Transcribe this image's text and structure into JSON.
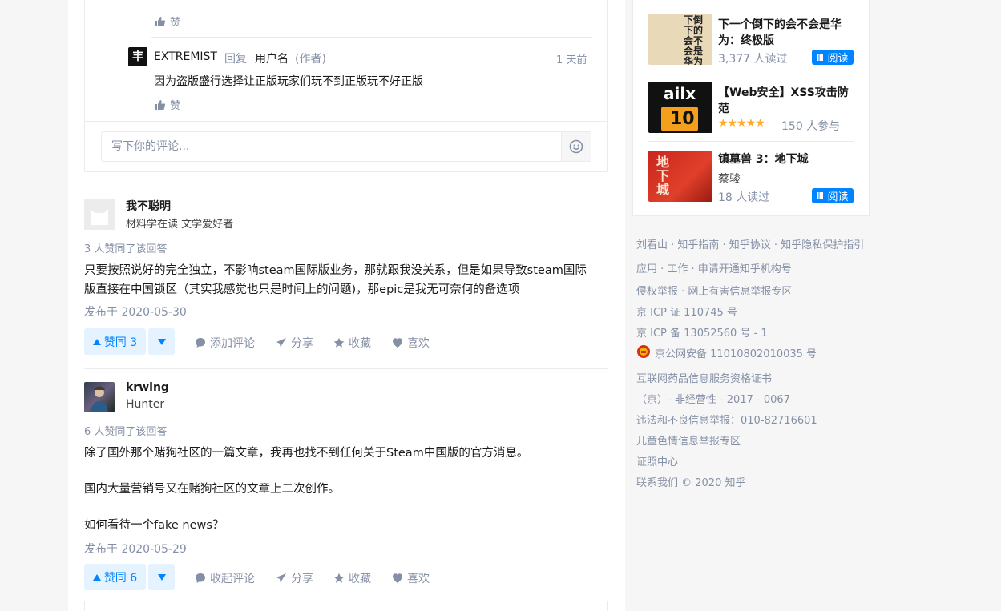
{
  "comments_box": {
    "top_like_label": "赞",
    "reply": {
      "author": "EXTREMIST",
      "reply_word": "回复",
      "target": "用户名",
      "author_tag": "(作者)",
      "time": "1 天前",
      "text": "因为盗版盛行选择让正版玩家们玩不到正版玩不好正版",
      "like_label": "赞"
    },
    "input_placeholder": "写下你的评论..."
  },
  "answers": [
    {
      "author": "我不聪明",
      "headline": "材料学在读 文学爱好者",
      "votes_text": "3 人赞同了该回答",
      "content": [
        "只要按照说好的完全独立，不影响steam国际版业务，那就跟我没关系，但是如果导致steam国际",
        "版直接在中国锁区（其实我感觉也只是时间上的问题)，那epic是我无可奈何的备选项"
      ],
      "published": "发布于 2020-05-30",
      "vote_label": "赞同 3",
      "comment_label": "添加评论",
      "share_label": "分享",
      "collect_label": "收藏",
      "like_label": "喜欢"
    },
    {
      "author": "krwlng",
      "headline": "Hunter",
      "votes_text": "6 人赞同了该回答",
      "content": [
        "除了国外那个赌狗社区的一篇文章，我再也找不到任何关于Steam中国版的官方消息。",
        "国内大量营销号又在赌狗社区的文章上二次创作。",
        "如何看待一个fake news？"
      ],
      "published": "发布于 2020-05-29",
      "vote_label": "赞同 6",
      "comment_label": "收起评论",
      "share_label": "分享",
      "collect_label": "收藏",
      "like_label": "喜欢"
    }
  ],
  "sidebar": {
    "books": [
      {
        "title_line1": "下一个倒下的会不会是华",
        "title_line2": "为：终极版",
        "meta": "3,377 人读过",
        "button": "阅读",
        "cover_text": "下倒下的会不会是华为"
      },
      {
        "title_line1": "【Web安全】XSS攻击防",
        "title_line2": "范",
        "stars": "★★★★★",
        "rating": 5,
        "meta": "150 人参与",
        "cover_top": "ailx",
        "cover_num": "10"
      },
      {
        "title_line1": "镇墓兽 3：地下城",
        "author": "蔡骏",
        "meta": "18 人读过",
        "button": "阅读",
        "cover_text": "地下城"
      }
    ],
    "footer": [
      "刘看山 · 知乎指南 · 知乎协议 · 知乎隐私保护指引",
      "应用 · 工作 · 申请开通知乎机构号",
      "侵权举报 · 网上有害信息举报专区",
      "京 ICP 证 110745 号",
      "京 ICP 备 13052560 号 - 1",
      "京公网安备 11010802010035 号",
      "互联网药品信息服务资格证书",
      "（京）- 非经营性 - 2017 - 0067",
      "违法和不良信息举报：010-82716601",
      "儿童色情信息举报专区",
      "证照中心",
      "联系我们 © 2020 知乎"
    ]
  },
  "colors": {
    "accent": "#0084ff",
    "muted": "#8590a6",
    "star": "#ffab2e"
  }
}
